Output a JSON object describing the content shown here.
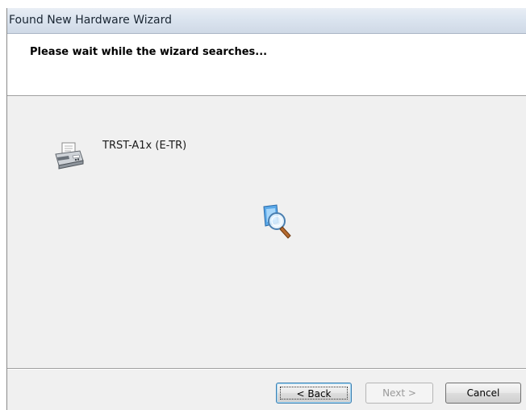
{
  "window": {
    "title": "Found New Hardware Wizard"
  },
  "header": {
    "heading": "Please wait while the wizard searches..."
  },
  "device": {
    "name": "TRST-A1x (E-TR)",
    "icon": "fax-printer-icon"
  },
  "status": {
    "icon": "search-magnifier-icon"
  },
  "buttons": {
    "back": "< Back",
    "next": "Next >",
    "cancel": "Cancel"
  },
  "colors": {
    "titlebar": "#dbe4ef",
    "dialog_bg": "#f0f0f0",
    "header_bg": "#ffffff",
    "disabled_text": "#9a9a9a"
  }
}
